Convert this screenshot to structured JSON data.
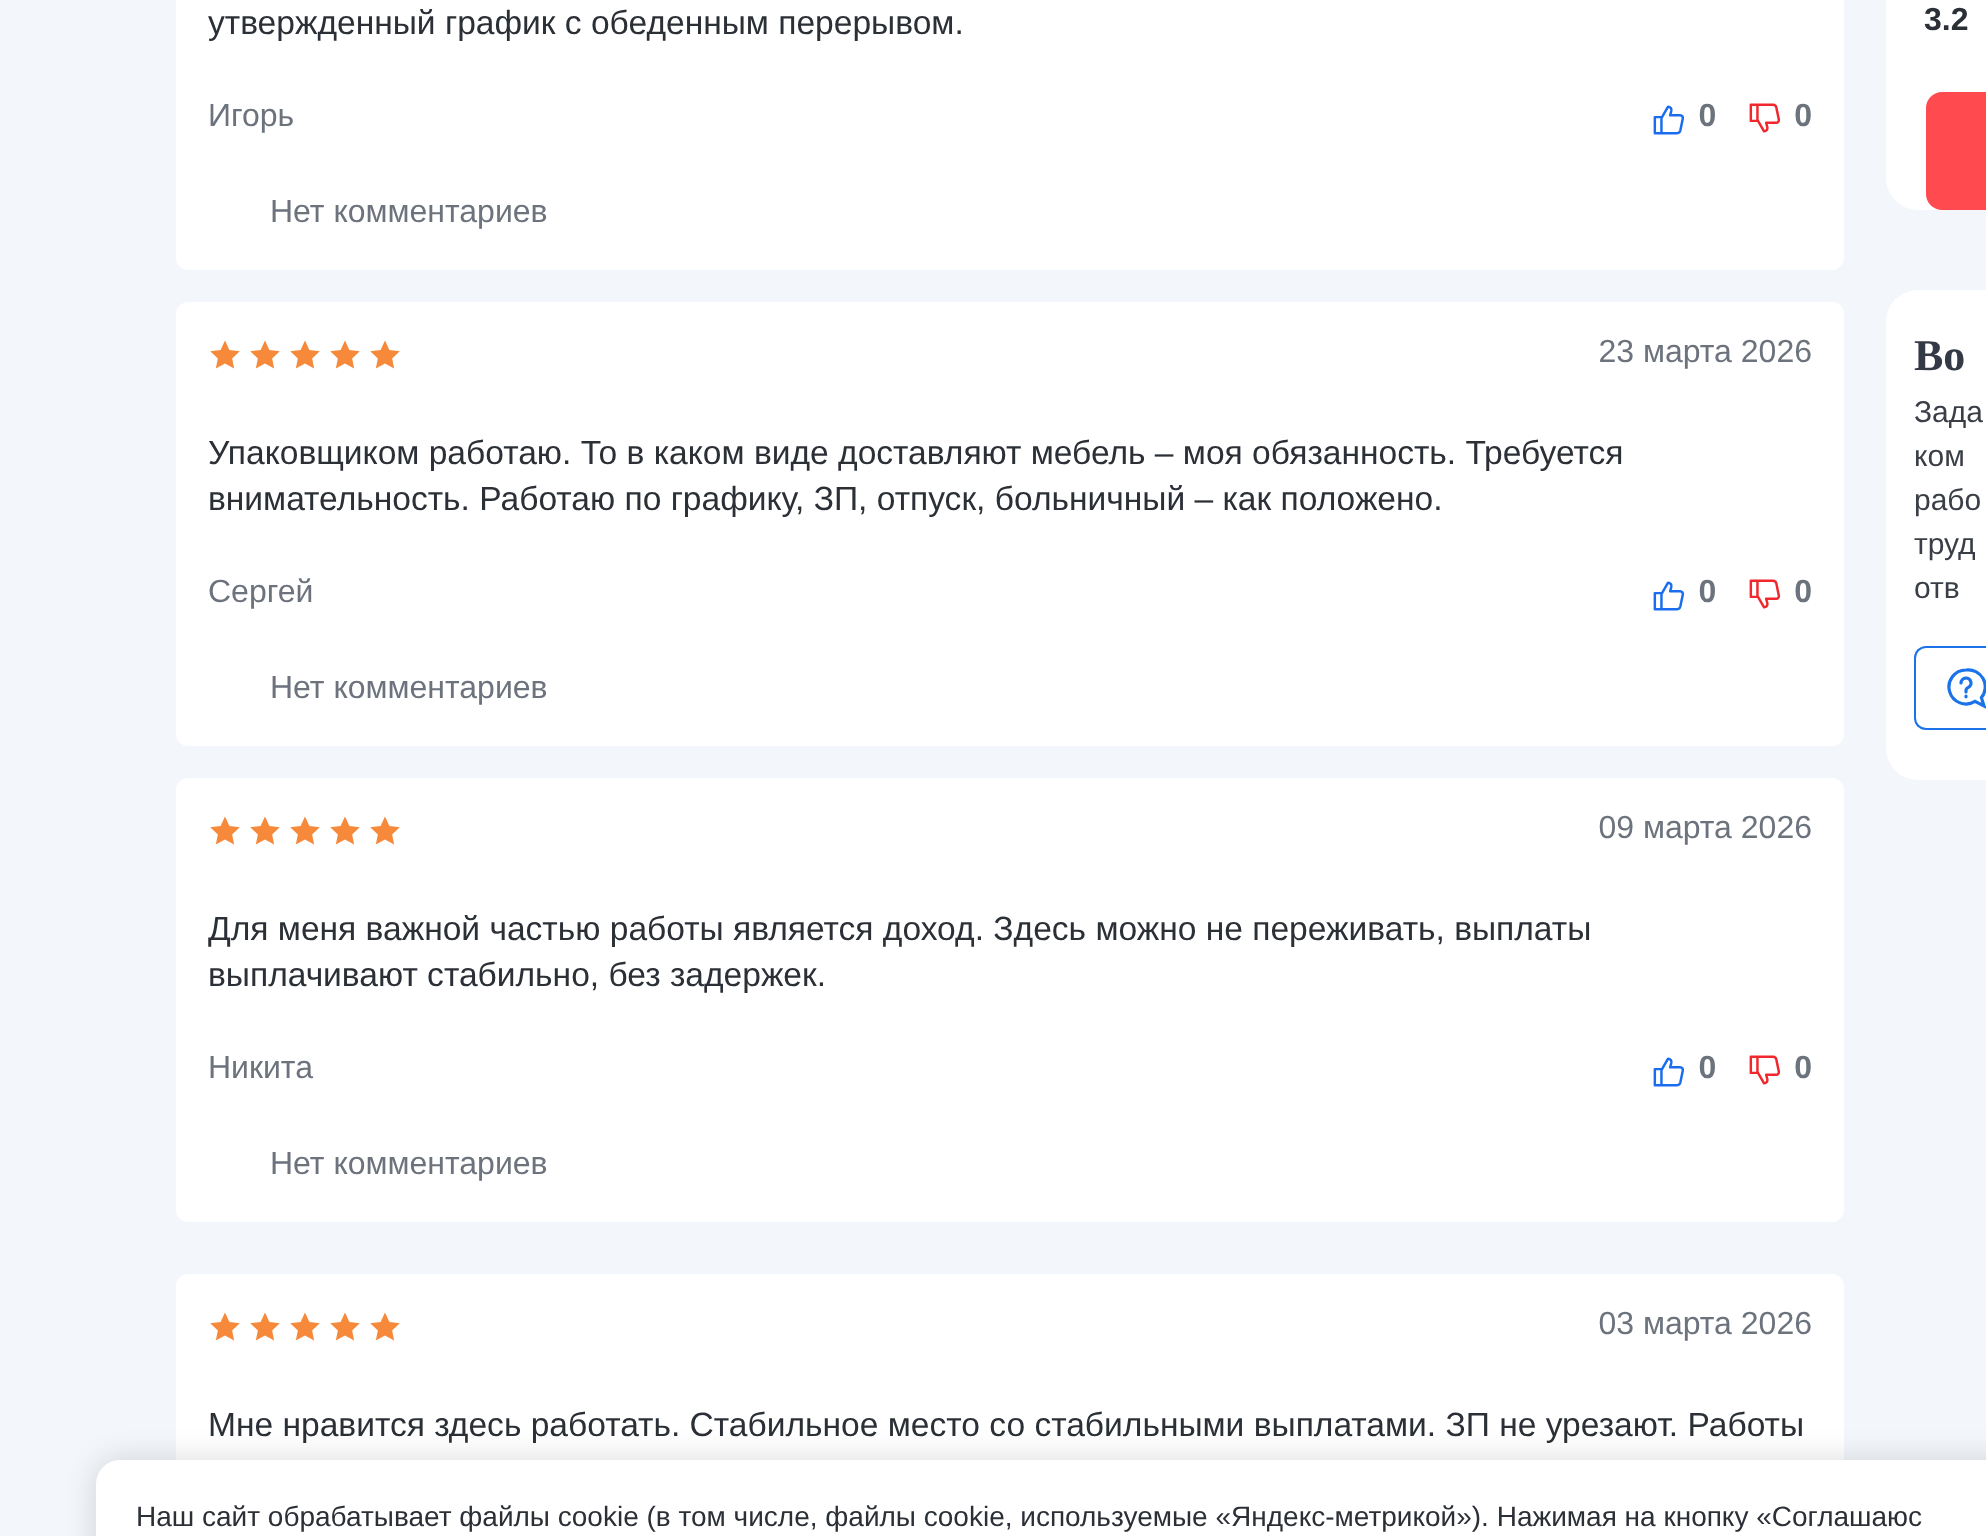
{
  "reviews": [
    {
      "text": "утвержденный график с обеденным перерывом.",
      "author": "Игорь",
      "likes": "0",
      "dislikes": "0",
      "comments": "Нет комментариев"
    },
    {
      "stars": 5,
      "date": "23 марта 2026",
      "text": "Упаковщиком работаю. То в каком виде доставляют мебель – моя обязанность. Требуется внимательность. Работаю по графику, ЗП, отпуск, больничный – как положено.",
      "author": "Сергей",
      "likes": "0",
      "dislikes": "0",
      "comments": "Нет комментариев"
    },
    {
      "stars": 5,
      "date": "09 марта 2026",
      "text": "Для меня важной частью работы является доход. Здесь можно не переживать, выплаты выплачивают стабильно, без задержек.",
      "author": "Никита",
      "likes": "0",
      "dislikes": "0",
      "comments": "Нет комментариев"
    },
    {
      "stars": 5,
      "date": "03 марта 2026",
      "text": "Мне нравится здесь работать. Стабильное место со стабильными выплатами. ЗП не урезают. Работы"
    }
  ],
  "sidebar": {
    "rating": "3.2",
    "question_card": {
      "title": "Во",
      "lines": [
        "Зада",
        "ком",
        "рабо",
        "труд",
        "отв"
      ]
    }
  },
  "cookie_banner": {
    "text": "Наш сайт обрабатывает файлы cookie (в том числе, файлы cookie, используемые «Яндекс-метрикой»). Нажимая на кнопку «Соглашаюс"
  }
}
